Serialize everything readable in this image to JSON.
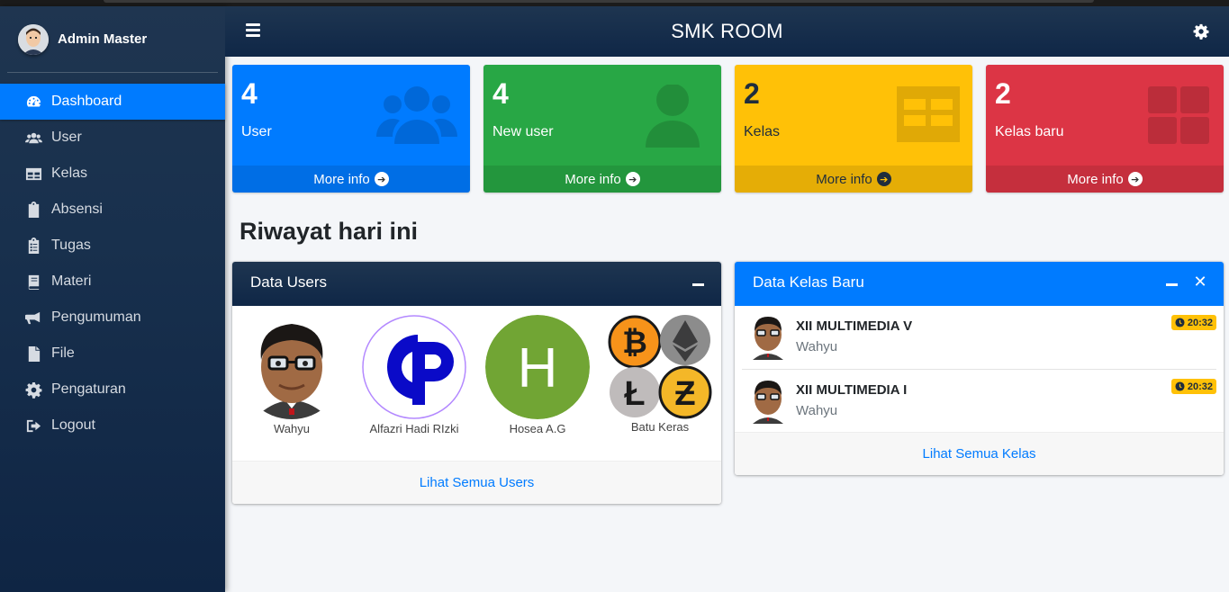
{
  "sidebar": {
    "user_name": "Admin Master",
    "items": [
      {
        "label": "Dashboard",
        "icon": "dashboard-icon",
        "active": true
      },
      {
        "label": "User",
        "icon": "users-icon"
      },
      {
        "label": "Kelas",
        "icon": "table-icon"
      },
      {
        "label": "Absensi",
        "icon": "clipboard-check-icon"
      },
      {
        "label": "Tugas",
        "icon": "clipboard-list-icon"
      },
      {
        "label": "Materi",
        "icon": "book-icon"
      },
      {
        "label": "Pengumuman",
        "icon": "bullhorn-icon"
      },
      {
        "label": "File",
        "icon": "file-icon"
      },
      {
        "label": "Pengaturan",
        "icon": "gear-icon"
      },
      {
        "label": "Logout",
        "icon": "logout-icon"
      }
    ]
  },
  "header": {
    "title": "SMK ROOM"
  },
  "stats": [
    {
      "value": "4",
      "label": "User",
      "more": "More info",
      "color": "#007bff",
      "icon": "users-icon"
    },
    {
      "value": "4",
      "label": "New user",
      "more": "More info",
      "color": "#28a745",
      "icon": "user-icon"
    },
    {
      "value": "2",
      "label": "Kelas",
      "more": "More info",
      "color": "#ffc107",
      "icon": "table-icon"
    },
    {
      "value": "2",
      "label": "Kelas baru",
      "more": "More info",
      "color": "#dc3545",
      "icon": "grid-icon"
    }
  ],
  "section_title": "Riwayat hari ini",
  "users_card": {
    "title": "Data Users",
    "users": [
      {
        "name": "Wahyu",
        "avatar": "cartoon-man-avatar"
      },
      {
        "name": "Alfazri Hadi RIzki",
        "avatar": "cp-logo-avatar"
      },
      {
        "name": "Hosea A.G",
        "avatar": "letter-h-avatar",
        "letter": "H"
      },
      {
        "name": "Batu Keras",
        "avatar": "crypto-coins-avatar"
      }
    ],
    "footer_link": "Lihat Semua Users"
  },
  "kelas_card": {
    "title": "Data Kelas Baru",
    "items": [
      {
        "title": "XII MULTIMEDIA V",
        "teacher": "Wahyu",
        "time": "20:32"
      },
      {
        "title": "XII MULTIMEDIA I",
        "teacher": "Wahyu",
        "time": "20:32"
      }
    ],
    "footer_link": "Lihat Semua Kelas"
  },
  "colors": {
    "primary": "#007bff",
    "navy": "#0f2747",
    "success": "#28a745",
    "warning": "#ffc107",
    "danger": "#dc3545"
  }
}
